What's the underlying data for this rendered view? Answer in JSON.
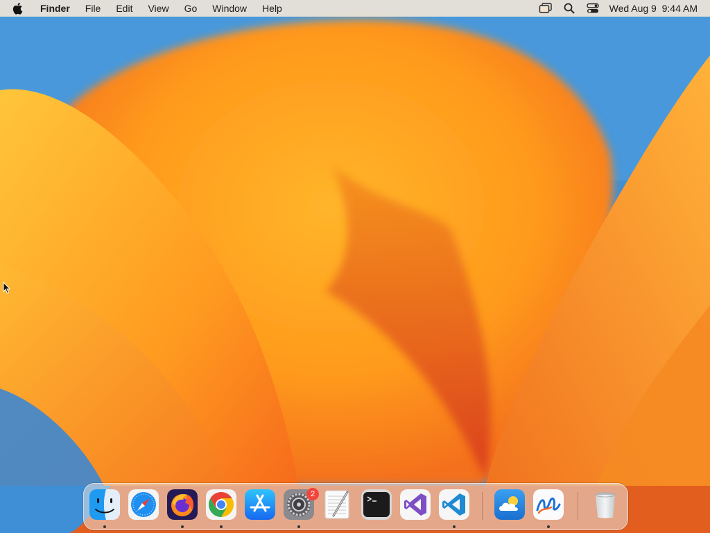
{
  "menubar": {
    "apple_icon": "apple-logo-icon",
    "app_name": "Finder",
    "menus": [
      "File",
      "Edit",
      "View",
      "Go",
      "Window",
      "Help"
    ],
    "status_icons": [
      "screen-mirroring-icon",
      "spotlight-search-icon",
      "control-center-icon"
    ],
    "clock": "Wed Aug 9  9:44 AM"
  },
  "wallpaper": {
    "name": "macOS Ventura",
    "colors": {
      "sky": "#3f8fd6",
      "petal_light": "#ffc53a",
      "petal_mid": "#ff9a1c",
      "petal_deep": "#e8531c"
    }
  },
  "dock": {
    "items": [
      {
        "name": "finder",
        "icon": "finder-icon",
        "running": true
      },
      {
        "name": "safari",
        "icon": "safari-compass-icon",
        "running": false
      },
      {
        "name": "firefox",
        "icon": "firefox-icon",
        "running": true
      },
      {
        "name": "chrome",
        "icon": "chrome-icon",
        "running": true
      },
      {
        "name": "app-store",
        "icon": "app-store-icon",
        "running": false
      },
      {
        "name": "system-settings",
        "icon": "system-settings-gear-icon",
        "running": true,
        "badge": "2"
      },
      {
        "name": "textedit",
        "icon": "textedit-icon",
        "running": false
      },
      {
        "name": "terminal",
        "icon": "terminal-icon",
        "running": false
      },
      {
        "name": "visual-studio",
        "icon": "visual-studio-icon",
        "running": false
      },
      {
        "name": "vscode",
        "icon": "vscode-icon",
        "running": true
      },
      {
        "name": "weather",
        "icon": "weather-cloud-icon",
        "running": false
      },
      {
        "name": "freeform",
        "icon": "freeform-icon",
        "running": true
      },
      {
        "name": "trash",
        "icon": "trash-icon",
        "running": false
      }
    ]
  }
}
